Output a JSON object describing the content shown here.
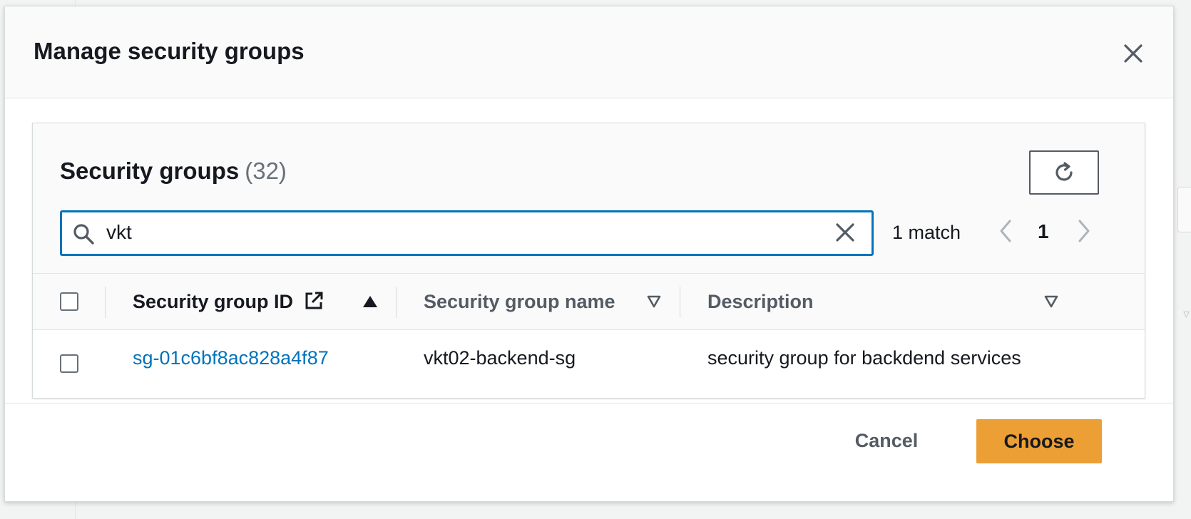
{
  "modal": {
    "title": "Manage security groups"
  },
  "panel": {
    "title": "Security groups",
    "count": "(32)"
  },
  "search": {
    "value": "vkt",
    "match_text": "1 match"
  },
  "pagination": {
    "current_page": "1"
  },
  "table": {
    "columns": [
      {
        "label": "Security group ID",
        "sort": "ascending"
      },
      {
        "label": "Security group name",
        "sort": "none"
      },
      {
        "label": "Description",
        "sort": "none"
      }
    ],
    "rows": [
      {
        "selected": false,
        "id": "sg-01c6bf8ac828a4f87",
        "name": "vkt02-backend-sg",
        "description": "security group for backdend services"
      }
    ]
  },
  "footer": {
    "cancel_label": "Cancel",
    "choose_label": "Choose"
  },
  "colors": {
    "accent_blue": "#0073bb",
    "primary_orange": "#ec9f35",
    "text_dark": "#16191f",
    "text_muted": "#545b64"
  },
  "icons": {
    "close": "close-icon",
    "refresh": "refresh-icon",
    "search": "search-icon",
    "clear": "clear-icon",
    "external_link": "external-link-icon",
    "sort_asc": "sort-ascending-icon",
    "sort_none": "sort-caret-down-icon",
    "prev": "chevron-left-icon",
    "next": "chevron-right-icon"
  }
}
